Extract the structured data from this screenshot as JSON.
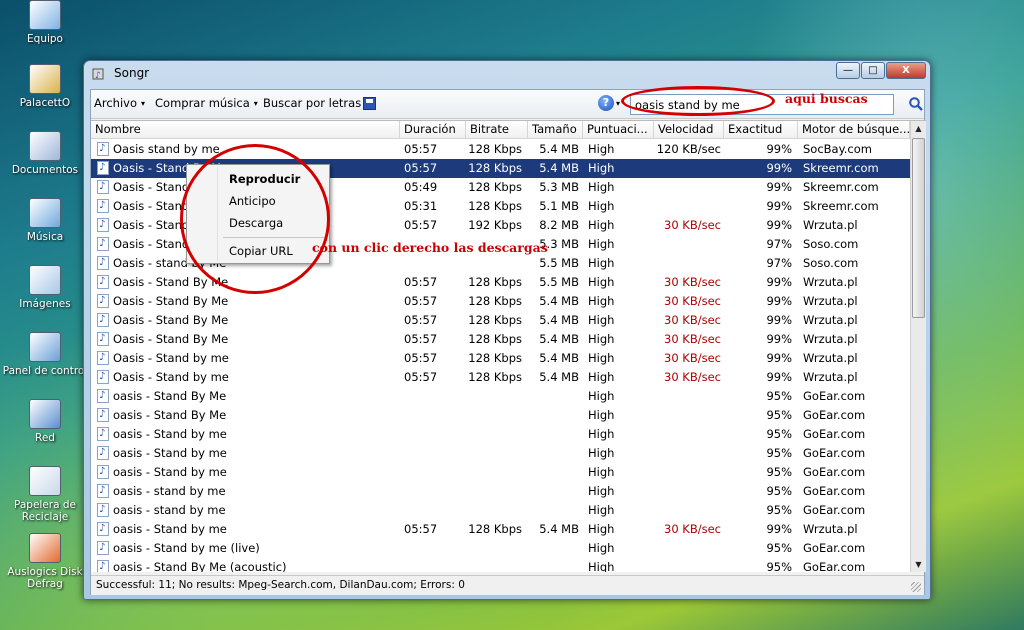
{
  "desktop": {
    "icons": [
      {
        "label": "Equipo",
        "icon": "computer-icon"
      },
      {
        "label": "PalacettO",
        "icon": "folder-icon"
      },
      {
        "label": "Documentos",
        "icon": "documents-icon"
      },
      {
        "label": "Música",
        "icon": "music-icon"
      },
      {
        "label": "Imágenes",
        "icon": "pictures-icon"
      },
      {
        "label": "Panel de control",
        "icon": "control-panel-icon"
      },
      {
        "label": "Red",
        "icon": "network-icon"
      },
      {
        "label": "Papelera de Reciclaje",
        "icon": "recycle-bin-icon"
      },
      {
        "label": "Auslogics Disk Defrag",
        "icon": "defrag-icon"
      }
    ]
  },
  "window": {
    "title": "Songr",
    "buttons": {
      "minimize": "—",
      "maximize": "□",
      "close": "X"
    }
  },
  "menubar": {
    "archivo": "Archivo",
    "comprar": "Comprar música",
    "buscar_letras": "Buscar por letras",
    "help_symbol": "?",
    "dropdown_arrow": "▾"
  },
  "search": {
    "value": "oasis stand by me",
    "button_icon": "magnifier-icon"
  },
  "annotations": {
    "search_note": "aqui buscas",
    "context_note": "con un clic derecho las descargas",
    "color": "#d40000"
  },
  "table": {
    "columns": [
      "Nombre",
      "Duración",
      "Bitrate",
      "Tamaño",
      "Puntuaci...",
      "Velocidad",
      "Exactitud",
      "Motor de búsque..."
    ],
    "selected_row": 1,
    "rows": [
      {
        "name": "Oasis stand by me",
        "dur": "05:57",
        "bitrate": "128 Kbps",
        "size": "5.4 MB",
        "score": "High",
        "speed": "120 KB/sec",
        "exact": "99%",
        "engine": "SocBay.com"
      },
      {
        "name": "Oasis - Stand By Me",
        "dur": "05:57",
        "bitrate": "128 Kbps",
        "size": "5.4 MB",
        "score": "High",
        "speed": "",
        "exact": "99%",
        "engine": "Skreemr.com"
      },
      {
        "name": "Oasis - Stand By Me",
        "dur": "05:49",
        "bitrate": "128 Kbps",
        "size": "5.3 MB",
        "score": "High",
        "speed": "",
        "exact": "99%",
        "engine": "Skreemr.com"
      },
      {
        "name": "Oasis - Stand By Me",
        "dur": "05:31",
        "bitrate": "128 Kbps",
        "size": "5.1 MB",
        "score": "High",
        "speed": "",
        "exact": "99%",
        "engine": "Skreemr.com"
      },
      {
        "name": "Oasis - Stand By Me",
        "dur": "05:57",
        "bitrate": "192 Kbps",
        "size": "8.2 MB",
        "score": "High",
        "speed": "30 KB/sec",
        "exact": "99%",
        "engine": "Wrzuta.pl"
      },
      {
        "name": "Oasis - Stand By Me",
        "dur": "",
        "bitrate": "",
        "size": "5.3 MB",
        "score": "High",
        "speed": "",
        "exact": "97%",
        "engine": "Soso.com"
      },
      {
        "name": "Oasis - stand by Me",
        "dur": "",
        "bitrate": "",
        "size": "5.5 MB",
        "score": "High",
        "speed": "",
        "exact": "97%",
        "engine": "Soso.com"
      },
      {
        "name": "Oasis - Stand By Me",
        "dur": "05:57",
        "bitrate": "128 Kbps",
        "size": "5.5 MB",
        "score": "High",
        "speed": "30 KB/sec",
        "exact": "99%",
        "engine": "Wrzuta.pl"
      },
      {
        "name": "Oasis - Stand By Me",
        "dur": "05:57",
        "bitrate": "128 Kbps",
        "size": "5.4 MB",
        "score": "High",
        "speed": "30 KB/sec",
        "exact": "99%",
        "engine": "Wrzuta.pl"
      },
      {
        "name": "Oasis - Stand By Me",
        "dur": "05:57",
        "bitrate": "128 Kbps",
        "size": "5.4 MB",
        "score": "High",
        "speed": "30 KB/sec",
        "exact": "99%",
        "engine": "Wrzuta.pl"
      },
      {
        "name": "Oasis - Stand By Me",
        "dur": "05:57",
        "bitrate": "128 Kbps",
        "size": "5.4 MB",
        "score": "High",
        "speed": "30 KB/sec",
        "exact": "99%",
        "engine": "Wrzuta.pl"
      },
      {
        "name": "Oasis - Stand by me",
        "dur": "05:57",
        "bitrate": "128 Kbps",
        "size": "5.4 MB",
        "score": "High",
        "speed": "30 KB/sec",
        "exact": "99%",
        "engine": "Wrzuta.pl"
      },
      {
        "name": "Oasis - Stand by me",
        "dur": "05:57",
        "bitrate": "128 Kbps",
        "size": "5.4 MB",
        "score": "High",
        "speed": "30 KB/sec",
        "exact": "99%",
        "engine": "Wrzuta.pl"
      },
      {
        "name": "oasis - Stand By Me",
        "dur": "",
        "bitrate": "",
        "size": "",
        "score": "High",
        "speed": "",
        "exact": "95%",
        "engine": "GoEar.com"
      },
      {
        "name": "oasis - Stand By Me",
        "dur": "",
        "bitrate": "",
        "size": "",
        "score": "High",
        "speed": "",
        "exact": "95%",
        "engine": "GoEar.com"
      },
      {
        "name": "oasis - Stand by me",
        "dur": "",
        "bitrate": "",
        "size": "",
        "score": "High",
        "speed": "",
        "exact": "95%",
        "engine": "GoEar.com"
      },
      {
        "name": "oasis - Stand by me",
        "dur": "",
        "bitrate": "",
        "size": "",
        "score": "High",
        "speed": "",
        "exact": "95%",
        "engine": "GoEar.com"
      },
      {
        "name": "oasis - Stand by me",
        "dur": "",
        "bitrate": "",
        "size": "",
        "score": "High",
        "speed": "",
        "exact": "95%",
        "engine": "GoEar.com"
      },
      {
        "name": "oasis - stand by me",
        "dur": "",
        "bitrate": "",
        "size": "",
        "score": "High",
        "speed": "",
        "exact": "95%",
        "engine": "GoEar.com"
      },
      {
        "name": "oasis - stand by me",
        "dur": "",
        "bitrate": "",
        "size": "",
        "score": "High",
        "speed": "",
        "exact": "95%",
        "engine": "GoEar.com"
      },
      {
        "name": "oasis - Stand by me",
        "dur": "05:57",
        "bitrate": "128 Kbps",
        "size": "5.4 MB",
        "score": "High",
        "speed": "30 KB/sec",
        "exact": "99%",
        "engine": "Wrzuta.pl"
      },
      {
        "name": "oasis - Stand by me (live)",
        "dur": "",
        "bitrate": "",
        "size": "",
        "score": "High",
        "speed": "",
        "exact": "95%",
        "engine": "GoEar.com"
      },
      {
        "name": "oasis - Stand By Me (acoustic)",
        "dur": "",
        "bitrate": "",
        "size": "",
        "score": "High",
        "speed": "",
        "exact": "95%",
        "engine": "GoEar.com"
      }
    ]
  },
  "context_menu": {
    "items": [
      "Reproducir",
      "Anticipo",
      "Descarga",
      "Copiar URL"
    ]
  },
  "status": {
    "text": "Successful: 11; No results: Mpeg-Search.com, DilanDau.com; Errors: 0"
  }
}
